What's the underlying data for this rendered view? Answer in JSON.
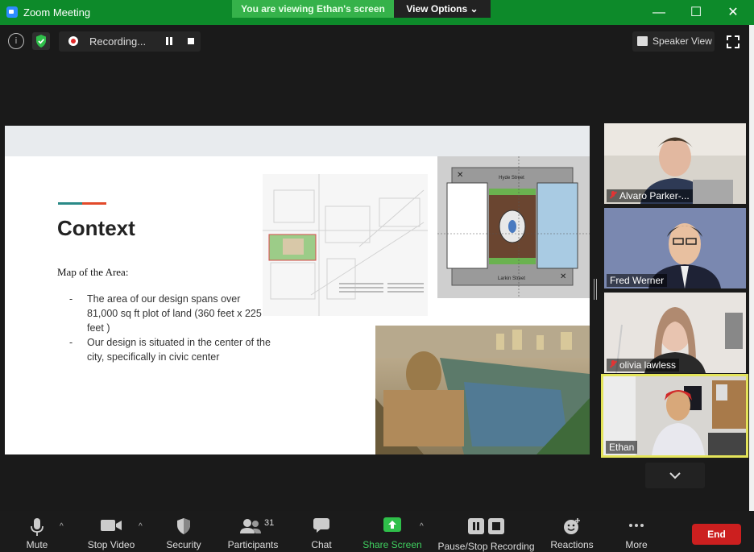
{
  "window": {
    "title": "Zoom Meeting"
  },
  "share_banner": {
    "status": "You are viewing Ethan's screen",
    "view_options": "View Options"
  },
  "top_bar": {
    "recording_label": "Recording...",
    "speaker_view_label": "Speaker View"
  },
  "slide": {
    "heading": "Context",
    "subheading": "Map of the Area:",
    "bullets": [
      "The area of our design spans over 81,000 sq ft plot of land (360 feet x 225 feet )",
      "Our design is situated in the center of the city, specifically in civic center"
    ],
    "plan_labels": {
      "top": "Hyde Street",
      "bottom": "Larkin Street"
    }
  },
  "participants": [
    {
      "name": "Alvaro Parker-...",
      "muted": true
    },
    {
      "name": "Fred Werner",
      "muted": false
    },
    {
      "name": "olivia lawless",
      "muted": true
    },
    {
      "name": "Ethan",
      "muted": false,
      "active_speaker": true
    }
  ],
  "toolbar": {
    "mute": "Mute",
    "stop_video": "Stop Video",
    "security": "Security",
    "participants": "Participants",
    "participants_count": "31",
    "chat": "Chat",
    "share_screen": "Share Screen",
    "pause_stop_recording": "Pause/Stop Recording",
    "reactions": "Reactions",
    "more": "More",
    "end": "End"
  },
  "colors": {
    "titlebar": "#0d8a2a",
    "share_green": "#35b24a",
    "end_red": "#cc1f1f",
    "active_border": "#e4e45a"
  }
}
